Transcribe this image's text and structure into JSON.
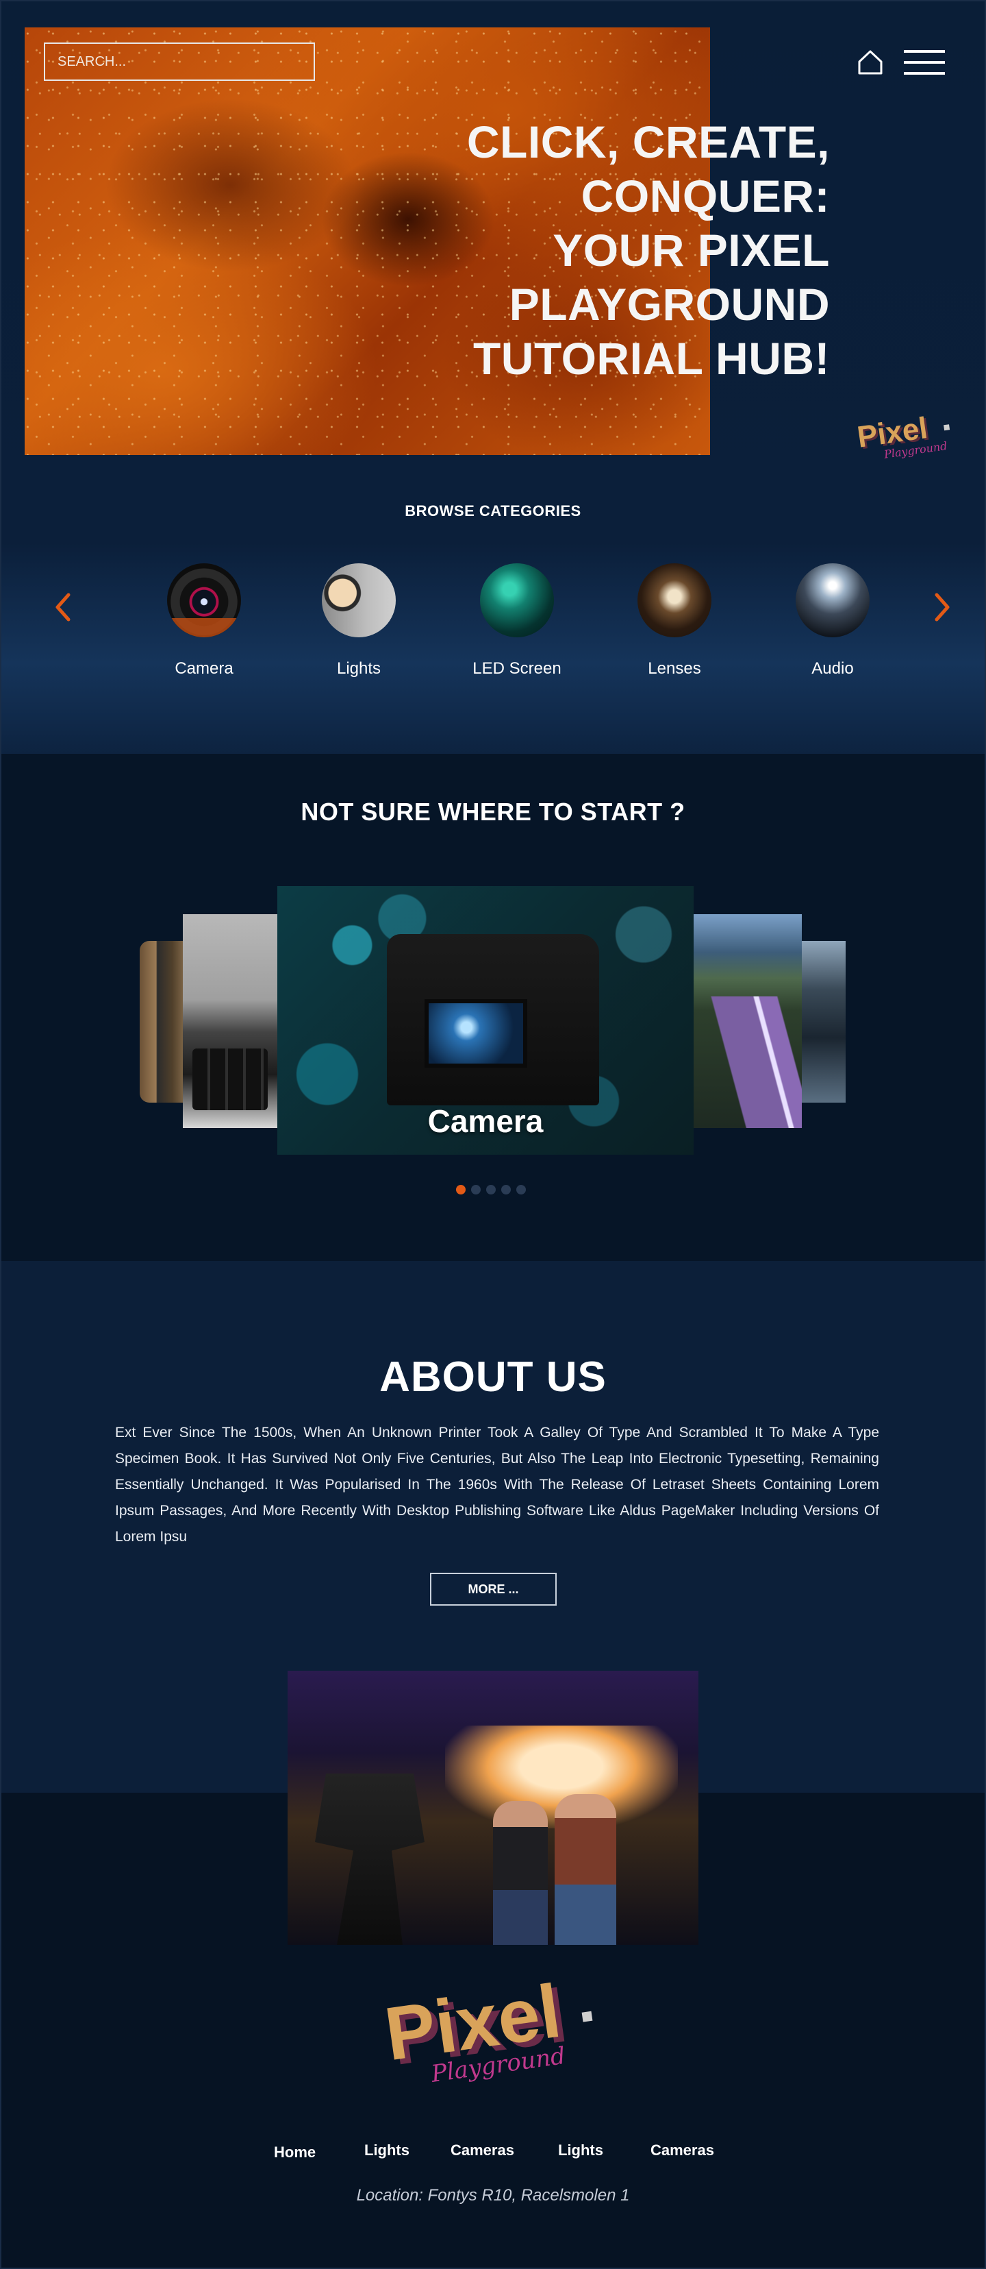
{
  "header": {
    "search_placeholder": "SEARCH...",
    "hero_title_lines": [
      "CLICK, CREATE,",
      "CONQUER:",
      "YOUR PIXEL",
      "PLAYGROUND",
      "TUTORIAL HUB!"
    ],
    "logo_icon": "pixel-playground-logo"
  },
  "categories": {
    "title": "BROWSE CATEGORIES",
    "items": [
      {
        "label": "Camera"
      },
      {
        "label": "Lights"
      },
      {
        "label": "LED Screen"
      },
      {
        "label": "Lenses"
      },
      {
        "label": "Audio"
      }
    ]
  },
  "start": {
    "title": "NOT SURE WHERE TO START ?",
    "active_slide_label": "Camera",
    "slide_count": 5,
    "active_slide": 0
  },
  "about": {
    "title": "ABOUT US",
    "text": "Ext Ever Since The 1500s, When An Unknown Printer Took A Galley Of Type And Scrambled It To Make A Type Specimen Book. It Has Survived Not Only Five Centuries, But Also The Leap Into Electronic Typesetting, Remaining Essentially Unchanged. It Was Popularised In The 1960s With The Release Of Letraset Sheets Containing Lorem Ipsum Passages, And More Recently With Desktop Publishing Software Like Aldus PageMaker Including Versions Of Lorem Ipsu",
    "more_label": "MORE ..."
  },
  "footer": {
    "nav": [
      {
        "label": "Home"
      },
      {
        "label": "Lights"
      },
      {
        "label": "Cameras"
      },
      {
        "label": "Lights"
      },
      {
        "label": "Cameras"
      }
    ],
    "location": "Location: Fontys R10, Racelsmolen 1"
  },
  "colors": {
    "accent": "#e35a16",
    "background": "#0b1a2f",
    "footer_background": "#061323"
  }
}
